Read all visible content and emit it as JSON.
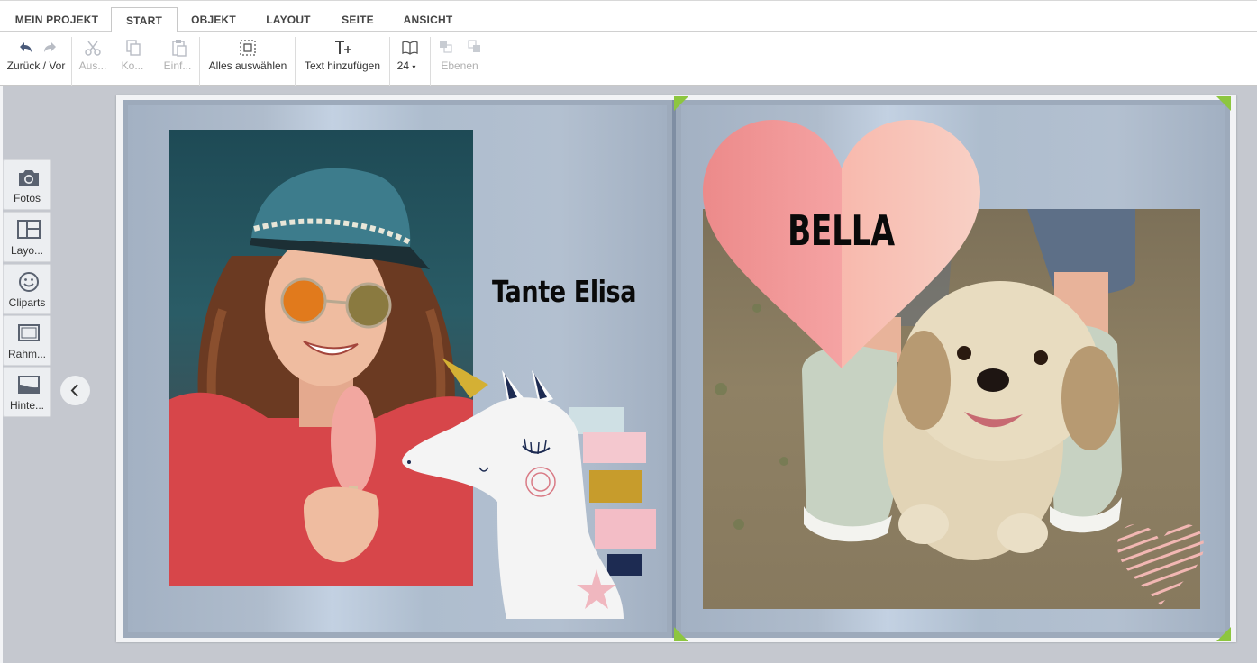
{
  "tabs": [
    {
      "label": "MEIN PROJEKT"
    },
    {
      "label": "START"
    },
    {
      "label": "OBJEKT"
    },
    {
      "label": "LAYOUT"
    },
    {
      "label": "SEITE"
    },
    {
      "label": "ANSICHT"
    }
  ],
  "active_tab": "START",
  "toolbar": {
    "undo_redo_label": "Zurück / Vor",
    "cut_label": "Aus...",
    "copy_label": "Ko...",
    "paste_label": "Einf...",
    "select_all_label": "Alles auswählen",
    "add_text_label": "Text hinzufügen",
    "page_count": "24",
    "layers_label": "Ebenen"
  },
  "sidebar": {
    "items": [
      {
        "label": "Fotos",
        "icon": "camera-icon"
      },
      {
        "label": "Layo...",
        "icon": "layout-icon"
      },
      {
        "label": "Cliparts",
        "icon": "smiley-icon"
      },
      {
        "label": "Rahm...",
        "icon": "frame-icon"
      },
      {
        "label": "Hinte...",
        "icon": "background-icon"
      }
    ]
  },
  "book": {
    "left_page": {
      "caption": "Tante Elisa"
    },
    "right_page": {
      "caption": "BELLA"
    }
  },
  "colors": {
    "accent_corner": "#8dc63f",
    "page_blue": "#b3c1d2",
    "heart_left": "#f08080",
    "heart_right": "#f8c9bd"
  }
}
